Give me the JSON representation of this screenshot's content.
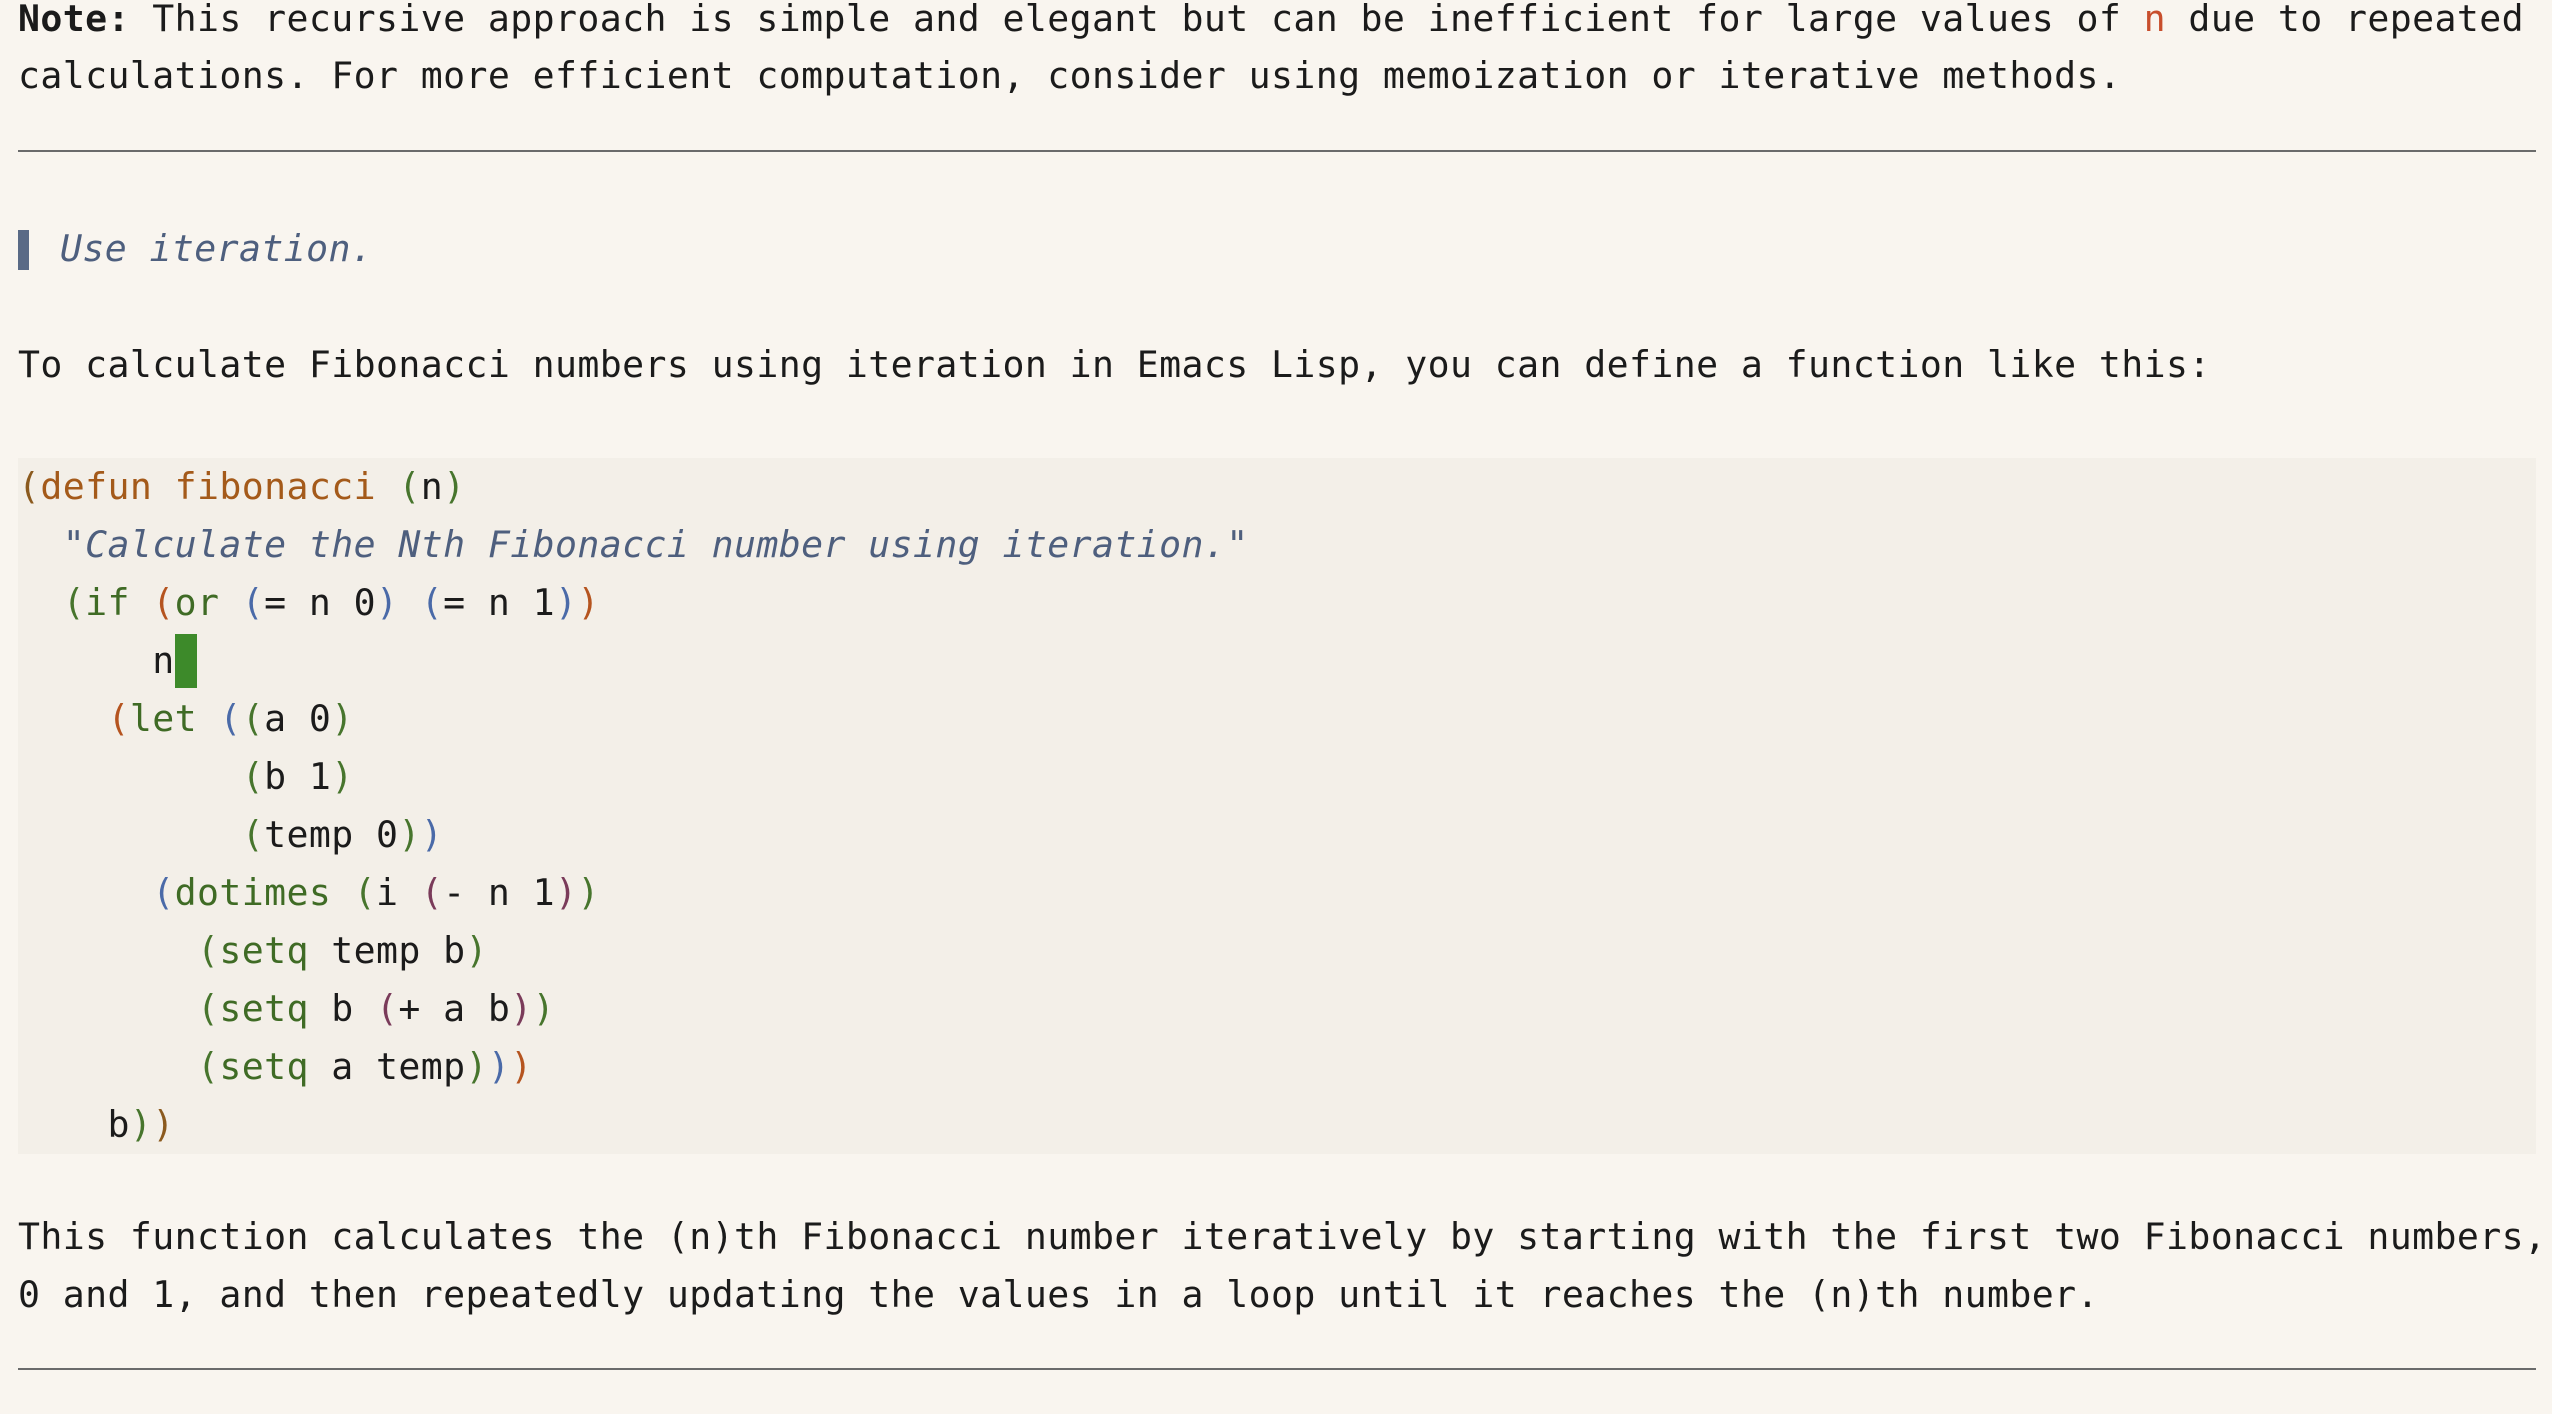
{
  "note": {
    "label": "Note:",
    "line1_before": " This recursive approach is simple and elegant but can be inefficient for large values of ",
    "line1_var": "n",
    "line1_after": " due to repeated",
    "line2": "calculations. For more efficient computation, consider using memoization or iterative methods."
  },
  "prompt": {
    "quote": "Use iteration."
  },
  "intro": "To calculate Fibonacci numbers using iteration in Emacs Lisp, you can define a function like this:",
  "code": {
    "l1_open": "(",
    "l1_kw": "defun",
    "l1_sp": " ",
    "l1_fn": "fibonacci",
    "l1_args_open": " (",
    "l1_args": "n",
    "l1_args_close": ")",
    "l2": "  \"Calculate the Nth Fibonacci number using iteration.\"",
    "l3_indent": "  ",
    "l3_open": "(",
    "l3_kw": "if",
    "l3_sp": " ",
    "l3_or_open": "(",
    "l3_or": "or",
    "l3_c1_open": " (",
    "l3_c1": "= n 0",
    "l3_c1_close": ")",
    "l3_c2_open": " (",
    "l3_c2": "= n 1",
    "l3_c2_close": ")",
    "l3_or_close": ")",
    "l4": "      n",
    "l5_indent": "    ",
    "l5_open": "(",
    "l5_kw": "let",
    "l5_bind_open": " (",
    "l5_a_open": "(",
    "l5_a": "a 0",
    "l5_a_close": ")",
    "l6_indent": "          ",
    "l6_open": "(",
    "l6": "b 1",
    "l6_close": ")",
    "l7_indent": "          ",
    "l7_open": "(",
    "l7": "temp 0",
    "l7_close": ")",
    "l7_bind_close": ")",
    "l8_indent": "      ",
    "l8_open": "(",
    "l8_kw": "dotimes",
    "l8_spec_open": " (",
    "l8_i": "i ",
    "l8_sub_open": "(",
    "l8_sub": "- n 1",
    "l8_sub_close": ")",
    "l8_spec_close": ")",
    "l9_indent": "        ",
    "l9_open": "(",
    "l9_kw": "setq",
    "l9_rest": " temp b",
    "l9_close": ")",
    "l10_indent": "        ",
    "l10_open": "(",
    "l10_kw": "setq",
    "l10_mid": " b ",
    "l10_add_open": "(",
    "l10_add": "+ a b",
    "l10_add_close": ")",
    "l10_close": ")",
    "l11_indent": "        ",
    "l11_open": "(",
    "l11_kw": "setq",
    "l11_rest": " a temp",
    "l11_close1": ")",
    "l11_close2": ")",
    "l11_close3": ")",
    "l12": "    b",
    "l12_close1": ")",
    "l12_close2": ")"
  },
  "explanation": {
    "line1": "This function calculates the (n)th Fibonacci number iteratively by starting with the first two Fibonacci numbers,",
    "line2": "0 and 1, and then repeatedly updating the values in a loop until it reaches the (n)th number."
  },
  "colors": {
    "background": "#f9f5ef",
    "code_background": "#f3efe8",
    "cursor": "#3d8a2a",
    "quote_bar": "#5a6a86",
    "highlight_var": "#c84e2c"
  }
}
